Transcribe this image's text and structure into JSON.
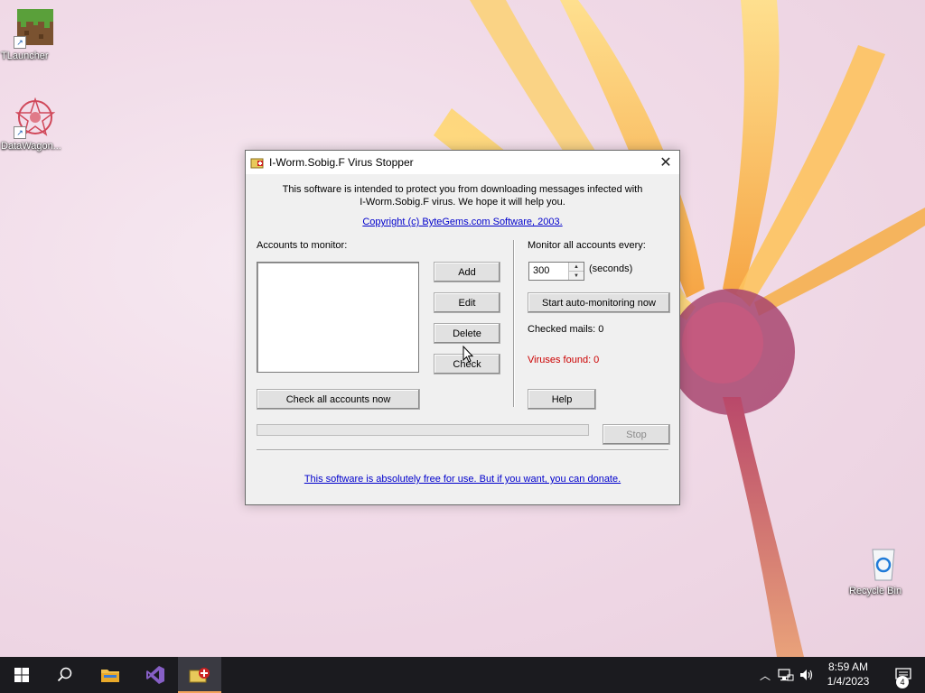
{
  "desktop": {
    "icons": [
      {
        "label": "TLauncher"
      },
      {
        "label": "DataWagon..."
      },
      {
        "label": "Recycle Bin"
      }
    ]
  },
  "window": {
    "title": "I-Worm.Sobig.F Virus Stopper",
    "close_glyph": "✕",
    "intro_line1": "This software is intended to protect you from downloading messages infected with",
    "intro_line2": "I-Worm.Sobig.F virus. We hope it will help you.",
    "copyright": "Copyright (c) ByteGems.com Software, 2003.",
    "accounts_label": "Accounts to monitor:",
    "buttons": {
      "add": "Add",
      "edit": "Edit",
      "delete": "Delete",
      "check": "Check",
      "check_all": "Check all accounts now",
      "start_auto": "Start auto-monitoring now",
      "help": "Help",
      "stop": "Stop"
    },
    "monitor_label": "Monitor all accounts every:",
    "interval_value": "300",
    "interval_unit": "(seconds)",
    "checked_mails": "Checked mails: 0",
    "viruses_found": "Viruses found: 0",
    "viruses_color": "#cc0000",
    "progress": 0,
    "donate": "This software is absolutely free for use. But if you want, you can donate."
  },
  "taskbar": {
    "time": "8:59 AM",
    "date": "1/4/2023",
    "notification_count": "4",
    "accent_color": "#f4a259"
  }
}
